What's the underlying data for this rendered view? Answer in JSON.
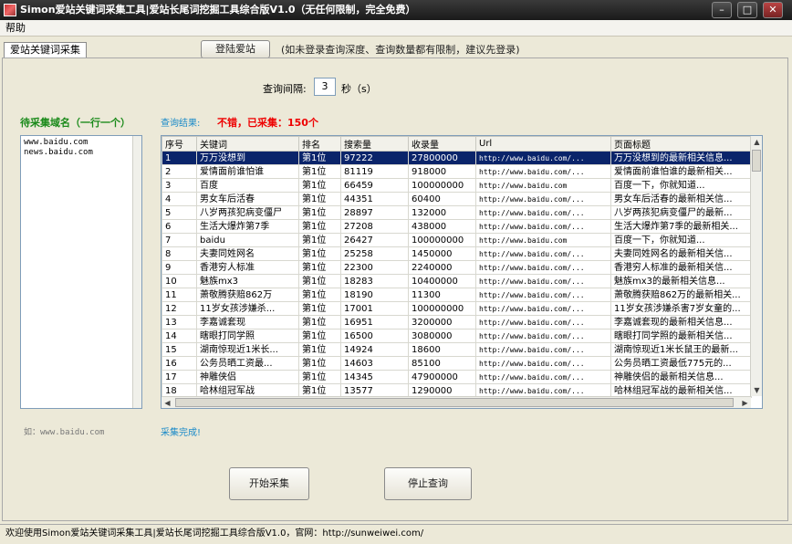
{
  "window": {
    "title": "Simon爱站关键词采集工具|爱站长尾词挖掘工具综合版V1.0（无任何限制，完全免费）",
    "min_icon": "minimize-icon",
    "max_icon": "maximize-icon",
    "close_icon": "close-icon"
  },
  "menu": {
    "help": "帮助"
  },
  "tab": {
    "label": "爱站关键词采集"
  },
  "login": {
    "button": "登陆爱站",
    "hint": "(如未登录查询深度、查询数量都有限制，建议先登录)"
  },
  "interval": {
    "label": "查询间隔:",
    "value": "3",
    "unit": "秒（s）"
  },
  "left": {
    "title": "待采集域名（一行一个）",
    "domains": "www.baidu.com\nnews.baidu.com",
    "footer": "如：www.baidu.com"
  },
  "result": {
    "label": "查询结果:",
    "value": "不错，已采集：150个",
    "status": "采集完成!"
  },
  "table": {
    "columns": [
      "序号",
      "关键词",
      "排名",
      "搜索量",
      "收录量",
      "Url",
      "页面标题"
    ],
    "rows": [
      [
        "1",
        "万万没想到",
        "第1位",
        "97222",
        "27800000",
        "http://www.baidu.com/...",
        "万万没想到的最新相关信息..."
      ],
      [
        "2",
        "爱情面前谁怕谁",
        "第1位",
        "81119",
        "918000",
        "http://www.baidu.com/...",
        "爱情面前谁怕谁的最新相关..."
      ],
      [
        "3",
        "百度",
        "第1位",
        "66459",
        "100000000",
        "http://www.baidu.com",
        "百度一下，你就知道..."
      ],
      [
        "4",
        "男女车后活春",
        "第1位",
        "44351",
        "60400",
        "http://www.baidu.com/...",
        "男女车后活春的最新相关信..."
      ],
      [
        "5",
        "八岁两孩犯病变僵尸",
        "第1位",
        "28897",
        "132000",
        "http://www.baidu.com/...",
        "八岁两孩犯病变僵尸的最新..."
      ],
      [
        "6",
        "生活大爆炸第7季",
        "第1位",
        "27208",
        "438000",
        "http://www.baidu.com/...",
        "生活大爆炸第7季的最新相关..."
      ],
      [
        "7",
        "baidu",
        "第1位",
        "26427",
        "100000000",
        "http://www.baidu.com",
        "百度一下，你就知道..."
      ],
      [
        "8",
        "夫妻同姓网名",
        "第1位",
        "25258",
        "1450000",
        "http://www.baidu.com/...",
        "夫妻同姓网名的最新相关信..."
      ],
      [
        "9",
        "香港穷人标准",
        "第1位",
        "22300",
        "2240000",
        "http://www.baidu.com/...",
        "香港穷人标准的最新相关信..."
      ],
      [
        "10",
        "魅族mx3",
        "第1位",
        "18283",
        "10400000",
        "http://www.baidu.com/...",
        "魅族mx3的最新相关信息..."
      ],
      [
        "11",
        "萧敬腾获赔862万",
        "第1位",
        "18190",
        "11300",
        "http://www.baidu.com/...",
        "萧敬腾获赔862万的最新相关..."
      ],
      [
        "12",
        "11岁女孩涉嫌杀...",
        "第1位",
        "17001",
        "100000000",
        "http://www.baidu.com/...",
        "11岁女孩涉嫌杀害7岁女童的..."
      ],
      [
        "13",
        "李嘉诚套现",
        "第1位",
        "16951",
        "3200000",
        "http://www.baidu.com/...",
        "李嘉诚套现的最新相关信息..."
      ],
      [
        "14",
        "瞎眼打同学照",
        "第1位",
        "16500",
        "3080000",
        "http://www.baidu.com/...",
        "瞎眼打同学照的最新相关信..."
      ],
      [
        "15",
        "湖南惊现近1米长...",
        "第1位",
        "14924",
        "18600",
        "http://www.baidu.com/...",
        "湖南惊现近1米长鼠王的最新..."
      ],
      [
        "16",
        "公务员晒工资最...",
        "第1位",
        "14603",
        "85100",
        "http://www.baidu.com/...",
        "公务员晒工资最低775元的..."
      ],
      [
        "17",
        "神雕侠侣",
        "第1位",
        "14345",
        "47900000",
        "http://www.baidu.com/...",
        "神雕侠侣的最新相关信息..."
      ],
      [
        "18",
        "哈林组冠军战",
        "第1位",
        "13577",
        "1290000",
        "http://www.baidu.com/...",
        "哈林组冠军战的最新相关信..."
      ]
    ]
  },
  "buttons": {
    "start": "开始采集",
    "stop": "停止查询"
  },
  "statusbar": {
    "text": "欢迎使用Simon爱站关键词采集工具|爱站长尾词挖掘工具综合版V1.0，官网：http://sunweiwei.com/"
  }
}
